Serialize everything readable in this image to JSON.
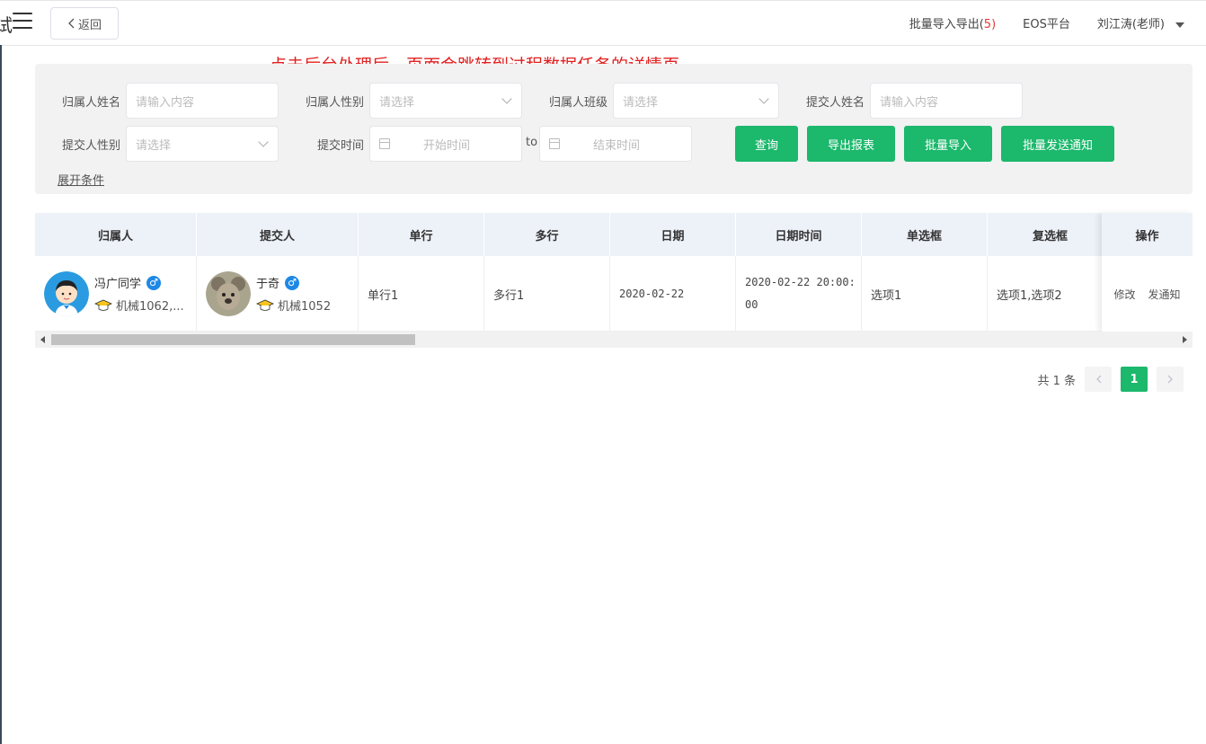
{
  "header": {
    "title_fragment": "试",
    "back_label": "返回",
    "batch_label": "批量导入导出(",
    "batch_count": "5",
    "batch_close": ")",
    "platform_label": "EOS平台",
    "user_label": "刘江涛(老师)"
  },
  "annotation": "点击后台处理后，页面会跳转到过程数据任务的详情页",
  "filters": {
    "owner_name_label": "归属人姓名",
    "owner_name_placeholder": "请输入内容",
    "owner_gender_label": "归属人性别",
    "owner_gender_placeholder": "请选择",
    "owner_class_label": "归属人班级",
    "owner_class_placeholder": "请选择",
    "submitter_name_label": "提交人姓名",
    "submitter_name_placeholder": "请输入内容",
    "submitter_gender_label": "提交人性别",
    "submitter_gender_placeholder": "请选择",
    "submit_time_label": "提交时间",
    "start_placeholder": "开始时间",
    "to": "to",
    "end_placeholder": "结束时间",
    "expand": "展开条件"
  },
  "buttons": {
    "query": "查询",
    "export": "导出报表",
    "import": "批量导入",
    "notify": "批量发送通知"
  },
  "table": {
    "headers": [
      "归属人",
      "提交人",
      "单行",
      "多行",
      "日期",
      "日期时间",
      "单选框",
      "复选框",
      "操作"
    ],
    "row": {
      "owner_name": "冯广同学",
      "owner_class": "机械1062,...",
      "submitter_name": "于奇",
      "submitter_class": "机械1052",
      "single_line": "单行1",
      "multi_line": "多行1",
      "date": "2020-02-22",
      "datetime": "2020-02-22 20:00:00",
      "radio": "选项1",
      "checkbox": "选项1,选项2",
      "action_edit": "修改",
      "action_notify": "发通知",
      "gender_symbol": "♂"
    }
  },
  "pagination": {
    "total": "共 1 条",
    "current_page": "1"
  },
  "colors": {
    "accent": "#1cb86c",
    "annotation": "#e02020",
    "male_badge": "#1e88e5"
  }
}
